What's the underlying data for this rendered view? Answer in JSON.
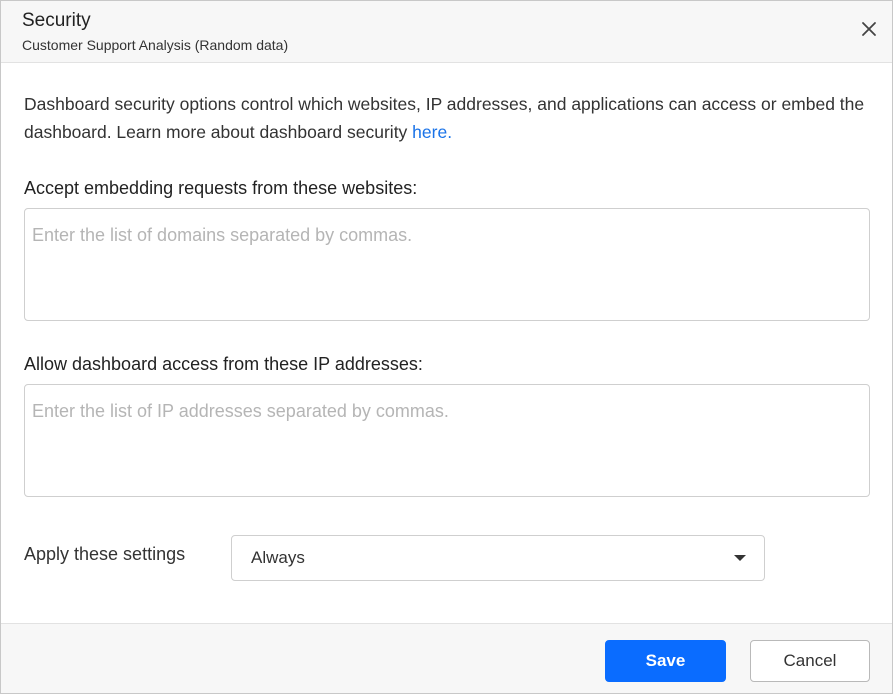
{
  "dialog": {
    "title": "Security",
    "subtitle": "Customer Support Analysis (Random data)",
    "close_icon": "close-icon"
  },
  "description": {
    "text": "Dashboard security options control which websites, IP addresses, and applications can access or embed the dashboard. Learn more about dashboard security ",
    "link_text": "here."
  },
  "websites": {
    "label": "Accept embedding requests from these websites:",
    "value": "",
    "placeholder": "Enter the list of domains separated by commas."
  },
  "ip_addresses": {
    "label": "Allow dashboard access from these IP addresses:",
    "value": "",
    "placeholder": "Enter the list of IP addresses separated by commas."
  },
  "apply": {
    "label": "Apply these settings",
    "selected": "Always",
    "dropdown_icon": "caret-down-icon"
  },
  "footer": {
    "save_label": "Save",
    "cancel_label": "Cancel"
  },
  "colors": {
    "primary": "#0a6cff",
    "link": "#1a73e8",
    "header_bg": "#f7f7f7"
  }
}
